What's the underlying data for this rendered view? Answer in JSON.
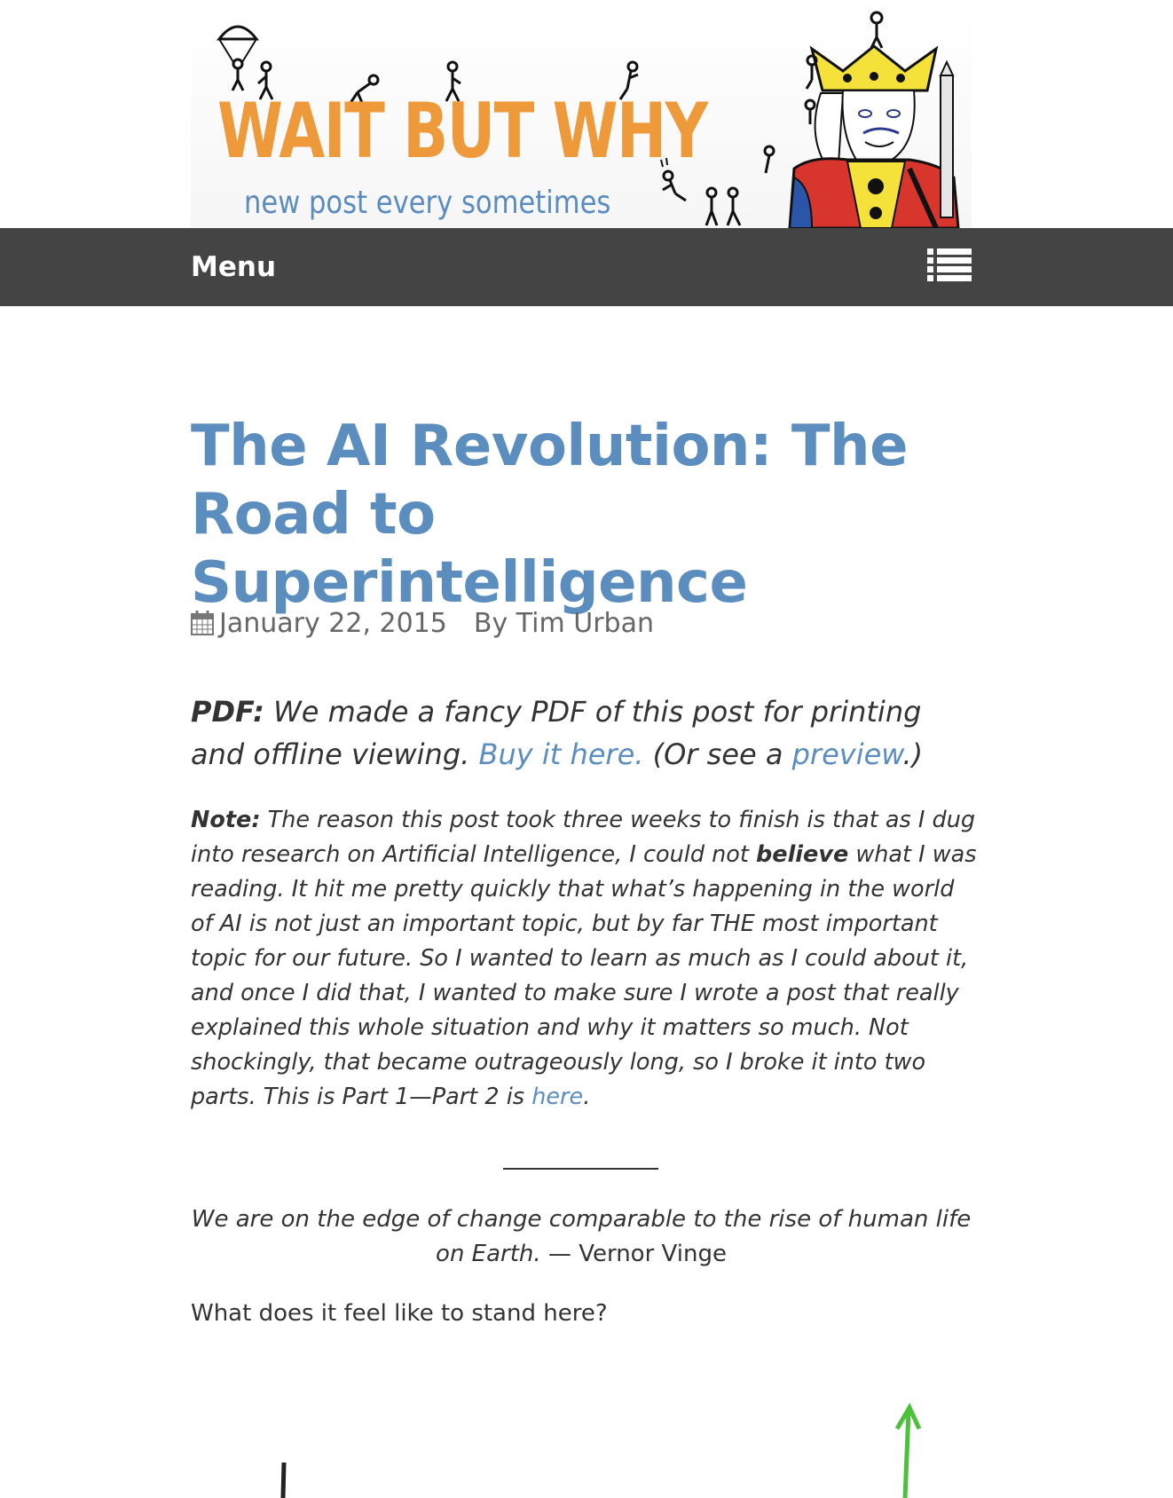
{
  "site": {
    "logo_text": "WAIT BUT WHY",
    "tagline": "new post every sometimes",
    "logo_color": "#ef9a3a",
    "tagline_color": "#5b8cbf"
  },
  "nav": {
    "menu_label": "Menu",
    "menu_icon": "list-icon",
    "background": "#444444"
  },
  "article": {
    "title": "The AI Revolution: The Road to Superintelligence",
    "date_icon": "calendar-icon",
    "date": "January 22, 2015",
    "author": "By Tim Urban",
    "pdf": {
      "label": "PDF:",
      "text_before": " We made a fancy PDF of this post for printing and offline viewing. ",
      "buy_link": "Buy it here.",
      "text_middle": " (Or see a ",
      "preview_link": "preview",
      "text_end": ".)"
    },
    "note": {
      "label": "Note:",
      "text_1": " The reason this post took three weeks to finish is that as I dug into research on Artificial Intelligence, I could not ",
      "bold_word": "believe",
      "text_2": " what I was reading. It hit me pretty quickly that what’s happening in the world of AI is not just an important topic, but by far THE most important topic for our future. So I wanted to learn as much as I could about it, and once I did that, I wanted to make sure I wrote a post that really explained this whole situation and why it matters so much. Not shockingly, that became outrageously long, so I broke it into two parts. This is Part 1—Part 2 is ",
      "here_link": "here",
      "text_end": "."
    },
    "quote": {
      "text": "We are on the edge of change comparable to the rise of human life on Earth.",
      "attribution": " — Vernor Vinge"
    },
    "question": "What does it feel like to stand here?"
  },
  "colors": {
    "link": "#5b8ebf",
    "title": "#5b8ebf",
    "body_text": "#333333",
    "graph_arrow": "#4cc13a"
  }
}
